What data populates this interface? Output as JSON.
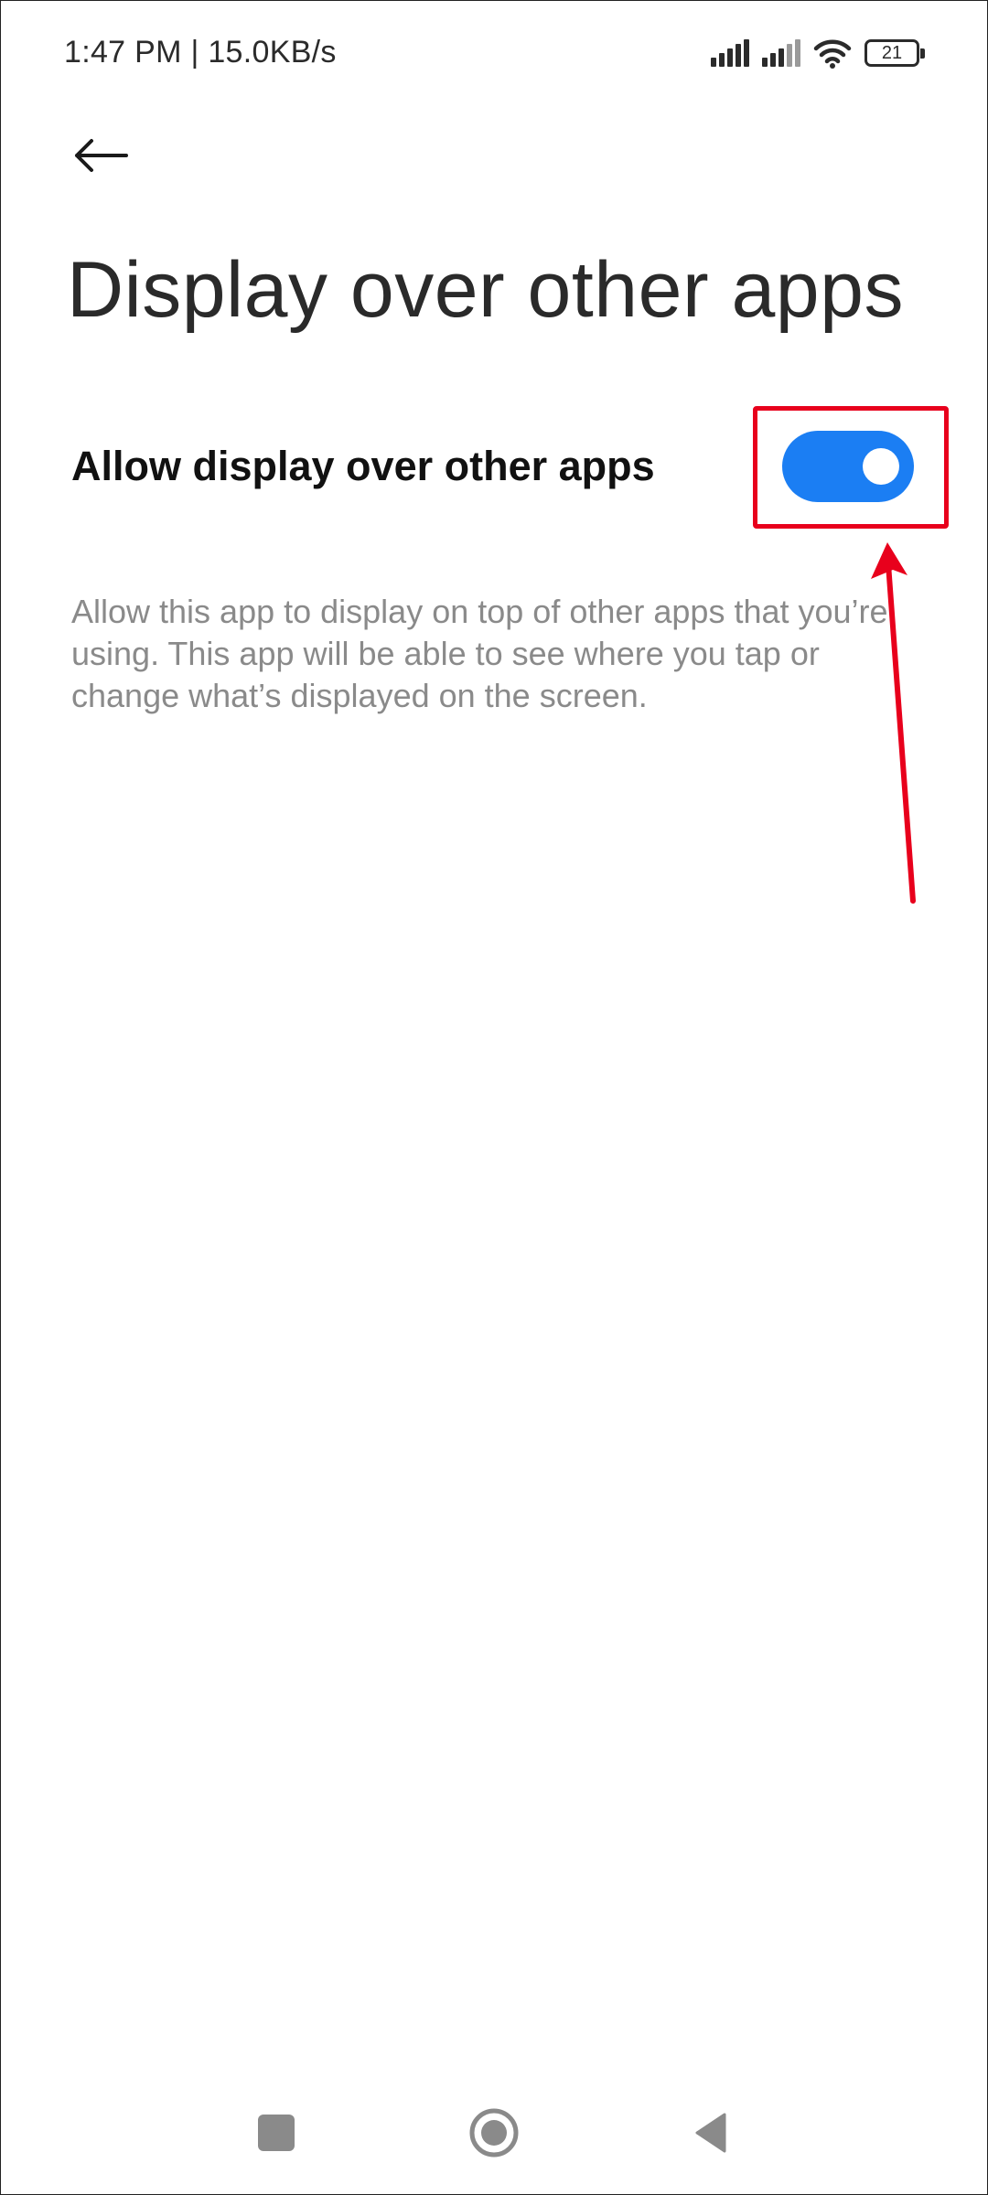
{
  "status_bar": {
    "time_speed": "1:47 PM | 15.0KB/s",
    "battery_level": "21",
    "icons": [
      "signal-icon",
      "signal-icon",
      "wifi-icon",
      "battery-icon"
    ]
  },
  "header": {
    "back_icon": "arrow-left-icon",
    "title": "Display over other apps"
  },
  "setting": {
    "label": "Allow display over other apps",
    "enabled": true,
    "toggle_color": "#1b7ef3",
    "description": "Allow this app to display on top of other apps that you’re using. This app will be able to see where you tap or change what’s displayed on the screen."
  },
  "annotation": {
    "highlight_color": "#e8001c"
  },
  "nav_bar": {
    "items": [
      "recents-icon",
      "home-icon",
      "back-icon"
    ]
  }
}
